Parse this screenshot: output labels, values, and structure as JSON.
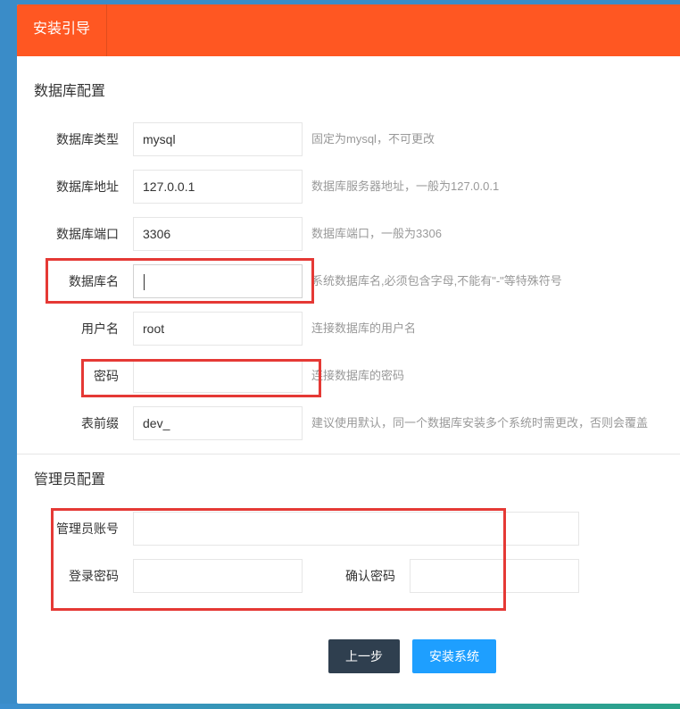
{
  "header": {
    "tab_label": "安装引导"
  },
  "db_section": {
    "title": "数据库配置",
    "rows": [
      {
        "label": "数据库类型",
        "value": "mysql",
        "hint": "固定为mysql，不可更改"
      },
      {
        "label": "数据库地址",
        "value": "127.0.0.1",
        "hint": "数据库服务器地址，一般为127.0.0.1"
      },
      {
        "label": "数据库端口",
        "value": "3306",
        "hint": "数据库端口，一般为3306"
      },
      {
        "label": "数据库名",
        "value": "",
        "hint": "系统数据库名,必须包含字母,不能有\"-\"等特殊符号"
      },
      {
        "label": "用户名",
        "value": "root",
        "hint": "连接数据库的用户名"
      },
      {
        "label": "密码",
        "value": "",
        "hint": "连接数据库的密码"
      },
      {
        "label": "表前缀",
        "value": "dev_",
        "hint": "建议使用默认，同一个数据库安装多个系统时需更改，否则会覆盖"
      }
    ]
  },
  "admin_section": {
    "title": "管理员配置",
    "account_label": "管理员账号",
    "account_value": "",
    "password_label": "登录密码",
    "password_value": "",
    "confirm_label": "确认密码",
    "confirm_value": ""
  },
  "buttons": {
    "prev": "上一步",
    "install": "安装系统"
  },
  "colors": {
    "header": "#ff5722",
    "prev_button": "#2f3f4f",
    "install_button": "#1e9fff",
    "highlight_box": "#e53935"
  }
}
